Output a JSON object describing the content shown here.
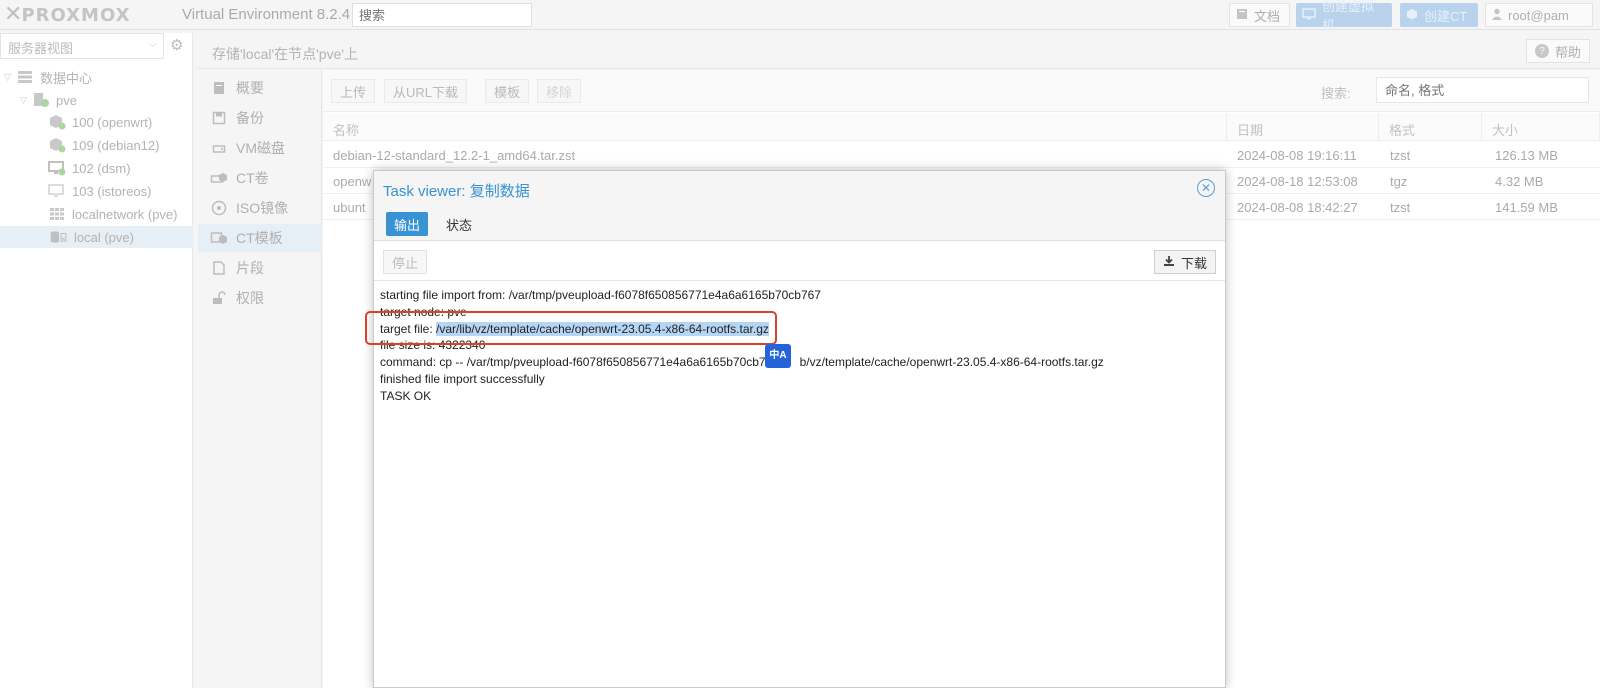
{
  "header": {
    "logo_text": "PROXMOX",
    "version": "Virtual Environment 8.2.4",
    "search_placeholder": "搜索",
    "doc_label": "文档",
    "create_vm_label": "创建虚拟机",
    "create_ct_label": "创建CT",
    "user_label": "root@pam"
  },
  "tree": {
    "view_label": "服务器视图",
    "items": [
      {
        "label": "数据中心",
        "icon": "server-stack-icon"
      },
      {
        "label": "pve",
        "icon": "node-icon"
      },
      {
        "label": "100 (openwrt)",
        "icon": "container-icon"
      },
      {
        "label": "109 (debian12)",
        "icon": "container-icon"
      },
      {
        "label": "102 (dsm)",
        "icon": "vm-icon"
      },
      {
        "label": "103 (istoreos)",
        "icon": "vm-icon"
      },
      {
        "label": "localnetwork (pve)",
        "icon": "network-grid-icon"
      },
      {
        "label": "local (pve)",
        "icon": "storage-icon"
      }
    ]
  },
  "main": {
    "title": "存储'local'在节点'pve'上",
    "help_label": "帮助"
  },
  "subnav": {
    "items": [
      {
        "label": "概要",
        "icon": "book-icon"
      },
      {
        "label": "备份",
        "icon": "floppy-icon"
      },
      {
        "label": "VM磁盘",
        "icon": "hdd-icon"
      },
      {
        "label": "CT卷",
        "icon": "ct-volume-icon"
      },
      {
        "label": "ISO镜像",
        "icon": "disc-icon"
      },
      {
        "label": "CT模板",
        "icon": "ct-template-icon"
      },
      {
        "label": "片段",
        "icon": "snippet-icon"
      },
      {
        "label": "权限",
        "icon": "unlock-icon"
      }
    ]
  },
  "toolbar": {
    "upload": "上传",
    "url_download": "从URL下载",
    "templates": "模板",
    "remove": "移除",
    "search_label": "搜索:",
    "search_placeholder": "命名, 格式"
  },
  "table": {
    "columns": [
      "名称",
      "日期",
      "格式",
      "大小"
    ],
    "rows": [
      {
        "name": "debian-12-standard_12.2-1_amd64.tar.zst",
        "date": "2024-08-08 19:16:11",
        "format": "tzst",
        "size": "126.13 MB"
      },
      {
        "name": "openw",
        "date": "2024-08-18 12:53:08",
        "format": "tgz",
        "size": "4.32 MB"
      },
      {
        "name": "ubunt",
        "date": "2024-08-08 18:42:27",
        "format": "tzst",
        "size": "141.59 MB"
      }
    ]
  },
  "modal": {
    "title_prefix": "Task viewer: ",
    "title_task": "复制数据",
    "tab_output": "输出",
    "tab_status": "状态",
    "stop_label": "停止",
    "download_label": "下载",
    "log": {
      "line1": "starting file import from: /var/tmp/pveupload-f6078f650856771e4a6a6165b70cb767",
      "line2": "target node: pve",
      "line3_prefix": "target file: ",
      "line3_path": "/var/lib/vz/template/cache/openwrt-23.05.4-x86-64-rootfs.tar.gz",
      "line4": "file size is: 4322340",
      "line5a": "command: cp -- /var/tmp/pveupload-f6078f650856771e4a6a6165b70cb767 /",
      "line5b": "b/vz/template/cache/openwrt-23.05.4-x86-64-rootfs.tar.gz",
      "line6": "finished file import successfully",
      "line7": "TASK OK"
    },
    "translate_badge": "中A"
  },
  "colors": {
    "accent": "#3892d3",
    "highlight_box": "#d9432d",
    "selection": "#b5d5f5"
  }
}
